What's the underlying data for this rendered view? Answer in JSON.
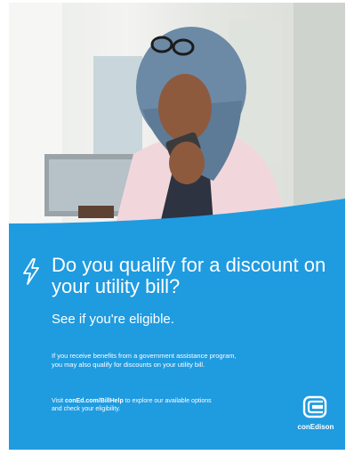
{
  "poster": {
    "headline": "Do you qualify for a discount on your utility bill?",
    "subhead": "See if you're eligible.",
    "body": "If you receive benefits from a government assistance program, you may also qualify for discounts on your utility bill.",
    "visit_prefix": "Visit ",
    "visit_link": "conEd.com/BillHelp",
    "visit_suffix": " to explore our available options and check your eligibility.",
    "logo_text": "conEdison"
  },
  "icons": {
    "bolt": "lightning-bolt-icon",
    "logo": "conedison-logo"
  },
  "colors": {
    "background_blue": "#1f9be0",
    "text": "#ffffff"
  }
}
